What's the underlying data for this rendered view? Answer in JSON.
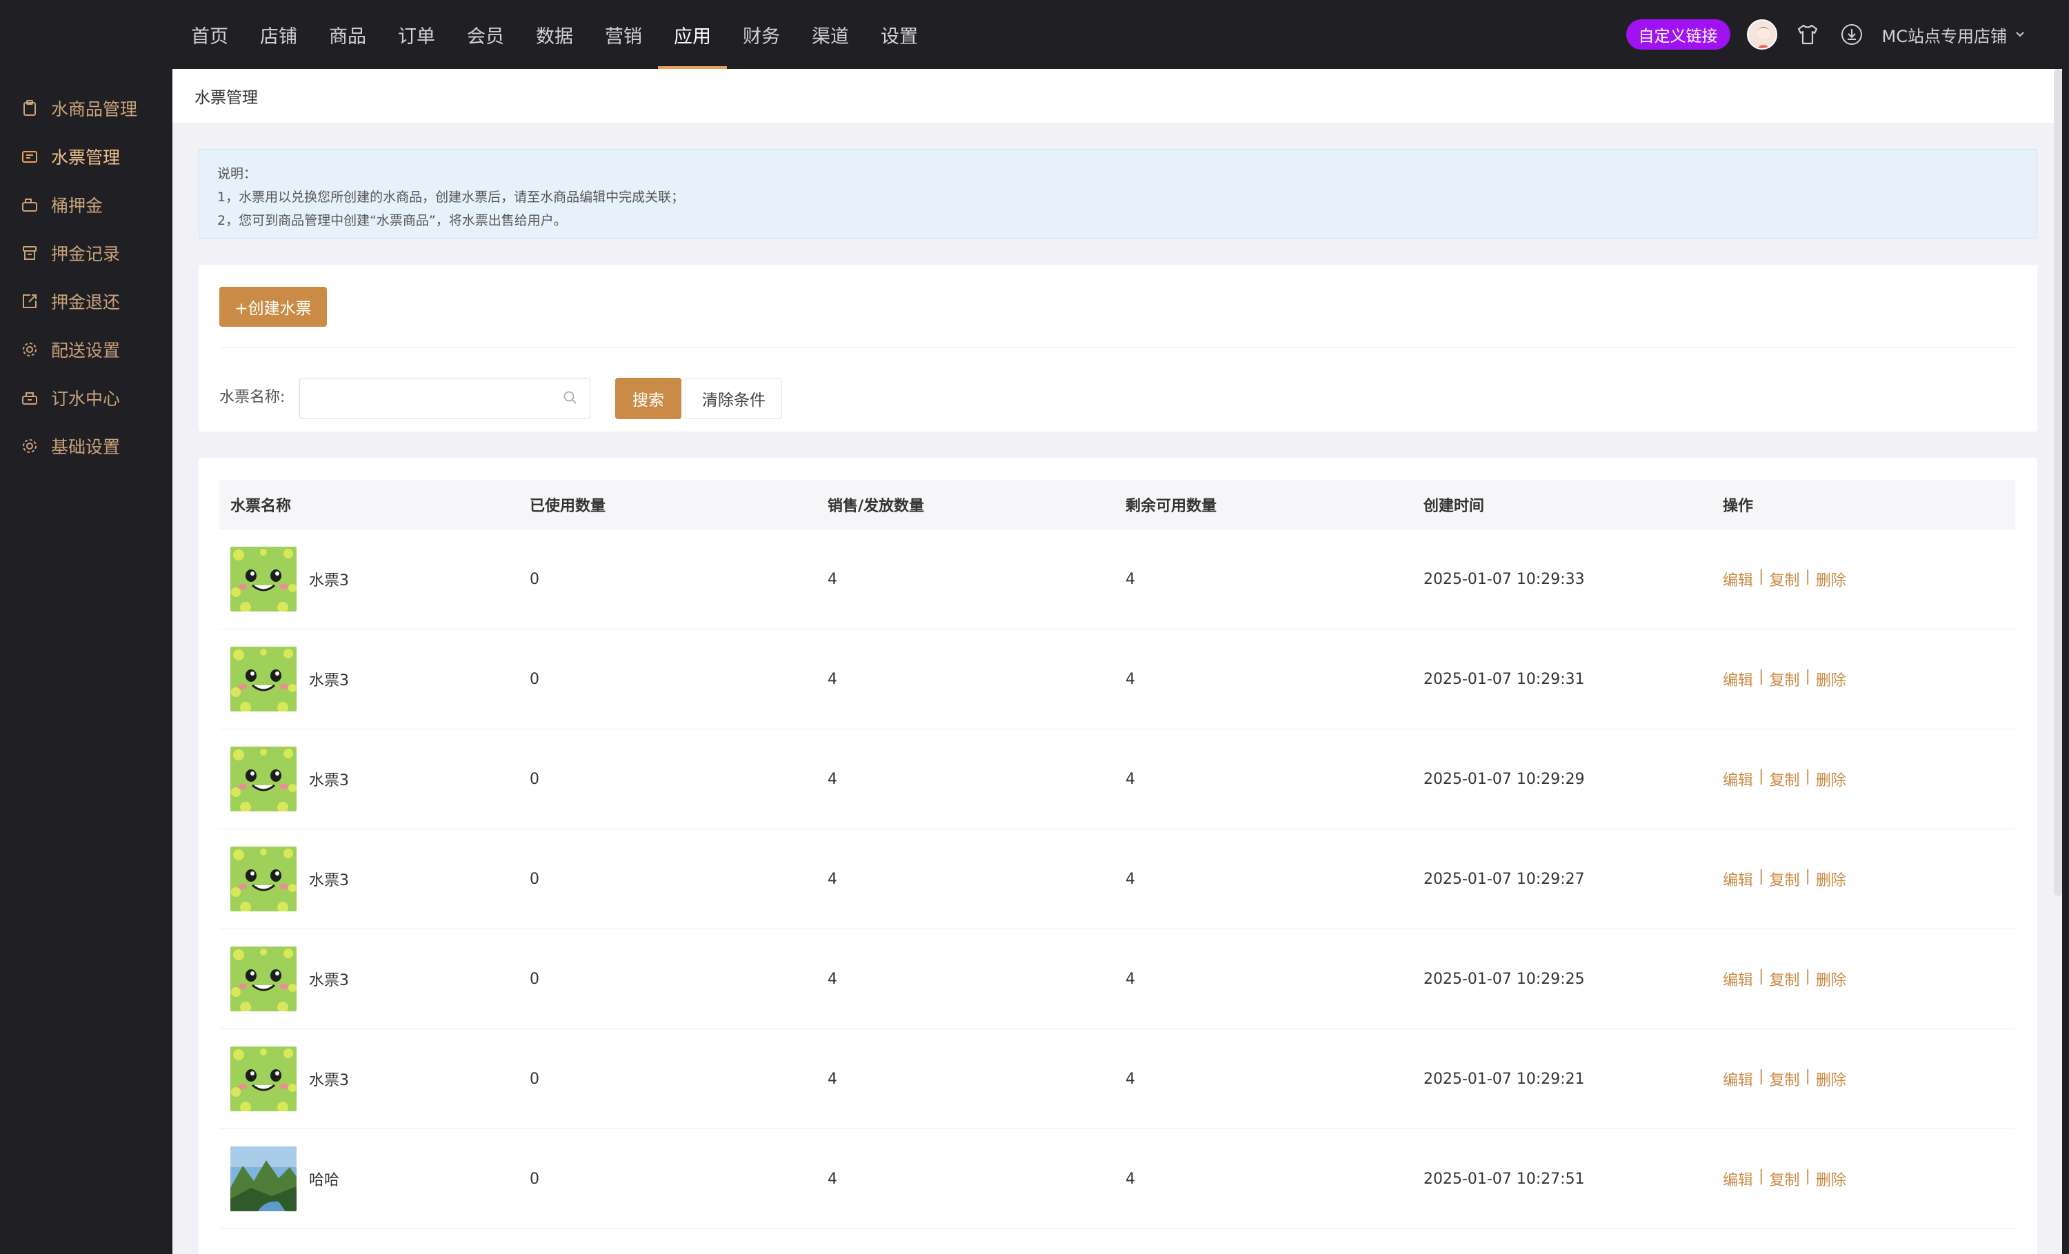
{
  "topnav": {
    "items": [
      "首页",
      "店铺",
      "商品",
      "订单",
      "会员",
      "数据",
      "营销",
      "应用",
      "财务",
      "渠道",
      "设置"
    ],
    "active_index": 7,
    "custom_link": "自定义链接",
    "store_name": "MC站点专用店铺"
  },
  "sidebar": {
    "items": [
      {
        "label": "水商品管理",
        "icon": "clipboard-icon"
      },
      {
        "label": "水票管理",
        "icon": "ticket-icon"
      },
      {
        "label": "桶押金",
        "icon": "deposit-icon"
      },
      {
        "label": "押金记录",
        "icon": "record-icon"
      },
      {
        "label": "押金退还",
        "icon": "refund-icon"
      },
      {
        "label": "配送设置",
        "icon": "gear-icon"
      },
      {
        "label": "订水中心",
        "icon": "order-center-icon"
      },
      {
        "label": "基础设置",
        "icon": "settings-icon"
      }
    ],
    "active_index": 1
  },
  "page": {
    "title": "水票管理",
    "notice": [
      "说明：",
      "1，水票用以兑换您所创建的水商品，创建水票后，请至水商品编辑中完成关联；",
      "2，您可到商品管理中创建“水票商品”，将水票出售给用户。"
    ]
  },
  "filter": {
    "create_label": "+创建水票",
    "name_label": "水票名称:",
    "name_value": "",
    "search_label": "搜索",
    "clear_label": "清除条件"
  },
  "table": {
    "headers": [
      "水票名称",
      "已使用数量",
      "销售/发放数量",
      "剩余可用数量",
      "创建时间",
      "操作"
    ],
    "rows": [
      {
        "name": "水票3",
        "used": "0",
        "sold": "4",
        "remaining": "4",
        "created": "2025-01-07 10:29:33",
        "thumb": "green-face"
      },
      {
        "name": "水票3",
        "used": "0",
        "sold": "4",
        "remaining": "4",
        "created": "2025-01-07 10:29:31",
        "thumb": "green-face"
      },
      {
        "name": "水票3",
        "used": "0",
        "sold": "4",
        "remaining": "4",
        "created": "2025-01-07 10:29:29",
        "thumb": "green-face"
      },
      {
        "name": "水票3",
        "used": "0",
        "sold": "4",
        "remaining": "4",
        "created": "2025-01-07 10:29:27",
        "thumb": "green-face"
      },
      {
        "name": "水票3",
        "used": "0",
        "sold": "4",
        "remaining": "4",
        "created": "2025-01-07 10:29:25",
        "thumb": "green-face"
      },
      {
        "name": "水票3",
        "used": "0",
        "sold": "4",
        "remaining": "4",
        "created": "2025-01-07 10:29:21",
        "thumb": "green-face"
      },
      {
        "name": "哈哈",
        "used": "0",
        "sold": "4",
        "remaining": "4",
        "created": "2025-01-07 10:27:51",
        "thumb": "landscape"
      }
    ],
    "ops": {
      "edit": "编辑",
      "copy": "复制",
      "delete": "删除",
      "separator": "|"
    }
  },
  "colors": {
    "accent": "#c98b46",
    "sidebar_text": "#c9a37a",
    "custom_link_bg": "#a112f2",
    "notice_bg": "#e7f1fc"
  }
}
